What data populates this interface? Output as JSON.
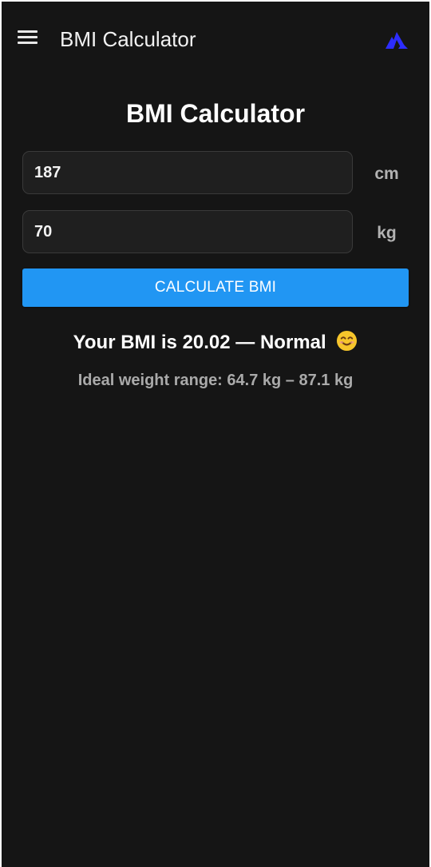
{
  "app_bar": {
    "title": "BMI Calculator",
    "menu_icon": "hamburger-menu-icon",
    "logo_icon": "mountain-logo-icon"
  },
  "main": {
    "heading": "BMI Calculator",
    "height_input": {
      "value": "187",
      "unit": "cm"
    },
    "weight_input": {
      "value": "70",
      "unit": "kg"
    },
    "calculate_button": "CALCULATE BMI",
    "result": {
      "text": "Your BMI is 20.02 — Normal",
      "emoji_icon": "smiling-face-icon"
    },
    "ideal_range": "Ideal weight range: 64.7 kg – 87.1 kg"
  },
  "colors": {
    "background": "#151515",
    "accent": "#2196f3",
    "input_background": "#1f1f1f",
    "logo": "#2d2dff"
  }
}
